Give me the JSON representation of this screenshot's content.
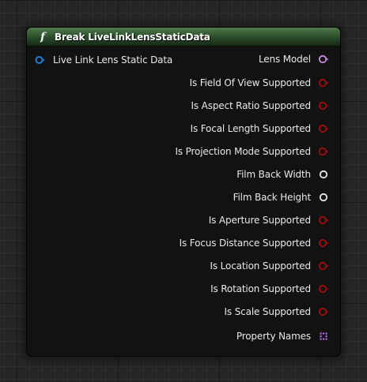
{
  "node": {
    "title": "Break LiveLinkLensStaticData",
    "icon": "function-icon",
    "icon_glyph": "f",
    "header_color": "#3b6237"
  },
  "input_pin": {
    "label": "Live Link Lens Static Data",
    "type": "struct-pin",
    "color": "#1f7fd6"
  },
  "output_pins": [
    {
      "label": "Lens Model",
      "type": "object-pin",
      "color": "#c88ce8"
    },
    {
      "label": "Is Field Of View Supported",
      "type": "bool-pin",
      "color": "#a50c0c"
    },
    {
      "label": "Is Aspect Ratio Supported",
      "type": "bool-pin",
      "color": "#a50c0c"
    },
    {
      "label": "Is Focal Length Supported",
      "type": "bool-pin",
      "color": "#a50c0c"
    },
    {
      "label": "Is Projection Mode Supported",
      "type": "bool-pin",
      "color": "#a50c0c"
    },
    {
      "label": "Film Back Width",
      "type": "float-pin",
      "color": "#e8e8e8"
    },
    {
      "label": "Film Back Height",
      "type": "float-pin",
      "color": "#e8e8e8"
    },
    {
      "label": "Is Aperture Supported",
      "type": "bool-pin",
      "color": "#a50c0c"
    },
    {
      "label": "Is Focus Distance Supported",
      "type": "bool-pin",
      "color": "#a50c0c"
    },
    {
      "label": "Is Location Supported",
      "type": "bool-pin",
      "color": "#a50c0c"
    },
    {
      "label": "Is Rotation Supported",
      "type": "bool-pin",
      "color": "#a50c0c"
    },
    {
      "label": "Is Scale Supported",
      "type": "bool-pin",
      "color": "#a50c0c"
    },
    {
      "label": "Property Names",
      "type": "name-set-pin",
      "color": "#b268e8"
    }
  ]
}
